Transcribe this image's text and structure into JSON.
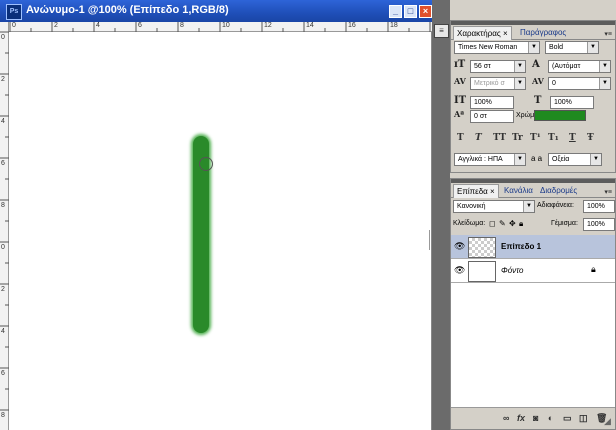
{
  "document": {
    "title": "Ανώνυμο-1 @100% (Επίπεδο 1,RGB/8)",
    "app_icon": "Ps",
    "ruler_top": [
      "0",
      "2",
      "4",
      "6",
      "8",
      "10",
      "12",
      "14",
      "16",
      "18"
    ],
    "ruler_left": [
      "0",
      "2",
      "4",
      "6",
      "8",
      "0",
      "2",
      "4",
      "6",
      "8"
    ],
    "stroke_color": "#2a8a2a",
    "window_buttons": {
      "minimize": "_",
      "maximize": "□",
      "close": "×"
    }
  },
  "dock": {
    "icon": "panel-icon"
  },
  "character_panel": {
    "tabs": [
      "Χαρακτήρας ×",
      "Παράγραφος"
    ],
    "font_family": "Times New Roman",
    "font_style": "Bold",
    "font_size": "56 στ",
    "leading": "(Αυτόματ",
    "kerning": "Μετρικό σ",
    "tracking": "0",
    "vertical_scale": "100%",
    "horizontal_scale": "100%",
    "baseline_shift": "0 στ",
    "color_label": "Χρώμα:",
    "color_value": "#1f8a1f",
    "format_buttons": [
      "T",
      "T",
      "TT",
      "Tr",
      "T¹",
      "T₁",
      "T",
      "Ŧ"
    ],
    "language": "Αγγλικά : ΗΠΑ",
    "aa_label": "a a",
    "antialias": "Οξεία"
  },
  "layers_panel": {
    "tabs": [
      "Επίπεδα ×",
      "Κανάλια",
      "Διαδρομές"
    ],
    "blend_mode": "Κανονική",
    "opacity_label": "Αδιαφάνεια:",
    "opacity": "100%",
    "lock_label": "Κλείδωμα:",
    "fill_label": "Γέμισμα:",
    "fill": "100%",
    "layers": [
      {
        "name": "Επίπεδο 1",
        "selected": true
      },
      {
        "name": "Φόντο",
        "selected": false
      }
    ]
  },
  "colors": {
    "title_bar": "#1f4fb8",
    "selection": "#b8c4dc",
    "panel": "#d4d0c8"
  }
}
